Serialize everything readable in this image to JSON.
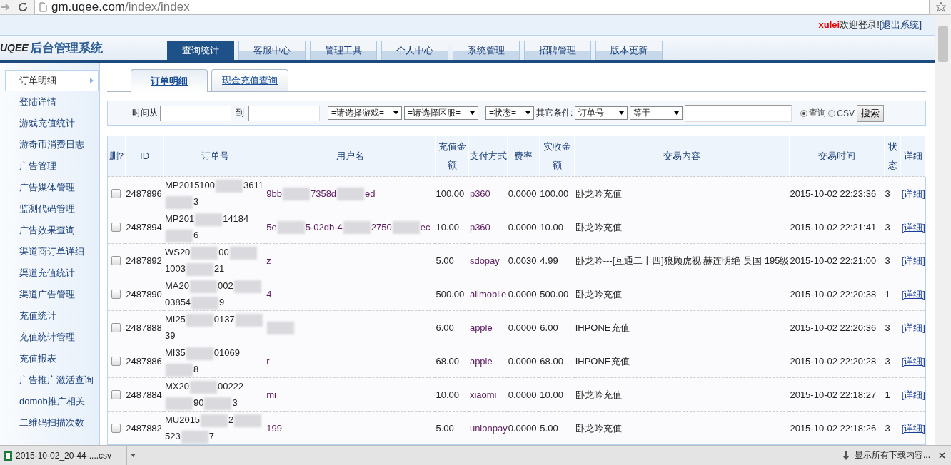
{
  "browser": {
    "url_host": "gm.uqee.com",
    "url_path": "/index/index"
  },
  "header": {
    "logo_brand": "UQEE",
    "logo_title": "后台管理系统",
    "user": "xulei",
    "welcome": "欢迎登录!",
    "logout": "[退出系统]"
  },
  "nav": [
    {
      "label": "查询统计",
      "selected": true
    },
    {
      "label": "客服中心",
      "selected": false
    },
    {
      "label": "管理工具",
      "selected": false
    },
    {
      "label": "个人中心",
      "selected": false
    },
    {
      "label": "系统管理",
      "selected": false
    },
    {
      "label": "招聘管理",
      "selected": false
    },
    {
      "label": "版本更新",
      "selected": false
    }
  ],
  "sidebar": {
    "items": [
      {
        "label": "订单明细",
        "selected": true
      },
      {
        "label": "登陆详情",
        "selected": false
      },
      {
        "label": "游戏充值统计",
        "selected": false
      },
      {
        "label": "游奇币消费日志",
        "selected": false
      },
      {
        "label": "广告管理",
        "selected": false
      },
      {
        "label": "广告媒体管理",
        "selected": false
      },
      {
        "label": "监测代码管理",
        "selected": false
      },
      {
        "label": "广告效果查询",
        "selected": false
      },
      {
        "label": "渠道商订单详细",
        "selected": false
      },
      {
        "label": "渠道充值统计",
        "selected": false
      },
      {
        "label": "渠道广告管理",
        "selected": false
      },
      {
        "label": "充值统计",
        "selected": false
      },
      {
        "label": "充值统计管理",
        "selected": false
      },
      {
        "label": "充值报表",
        "selected": false
      },
      {
        "label": "广告推广激活查询",
        "selected": false
      },
      {
        "label": "domob推广相关",
        "selected": false
      },
      {
        "label": "二维码扫描次数",
        "selected": false
      }
    ]
  },
  "tabs": [
    {
      "label": "订单明细",
      "selected": true
    },
    {
      "label": "现金充值查询",
      "selected": false
    }
  ],
  "filters": {
    "time_from_label": "时间从",
    "time_to_label": "到",
    "game_select": "=请选择游戏=",
    "server_select": "=请选择区服=",
    "status_select": "=状态=",
    "other_label": "其它条件:",
    "field_select": "订单号",
    "op_select": "等于",
    "modes": [
      {
        "label": "查询",
        "selected": true
      },
      {
        "label": "CSV",
        "selected": false
      }
    ],
    "search_button": "搜索"
  },
  "table": {
    "columns": [
      "删?",
      "ID",
      "订单号",
      "用户名",
      "充值金额",
      "支付方式",
      "费率",
      "实收金额",
      "交易内容",
      "交易时间",
      "状态",
      "详细"
    ],
    "rows": [
      {
        "checked": false,
        "id": "2487896",
        "order": [
          "MP2015100",
          "3611",
          "3"
        ],
        "user": [
          "9bb",
          "7358d",
          "ed"
        ],
        "amount": "100.00",
        "pay": "p360",
        "rate": "0.0000",
        "actual": "100.00",
        "content": "卧龙吟充值",
        "time": "2015-10-02 22:23:36",
        "status": "3",
        "detail": "[详细]"
      },
      {
        "checked": false,
        "id": "2487894",
        "order": [
          "MP201",
          "14184",
          "6"
        ],
        "user": [
          "5e",
          "5-02db-4",
          "2750",
          "ec"
        ],
        "amount": "10.00",
        "pay": "p360",
        "rate": "0.0000",
        "actual": "10.00",
        "content": "卧龙吟充值",
        "time": "2015-10-02 22:21:41",
        "status": "3",
        "detail": "[详细]"
      },
      {
        "checked": false,
        "id": "2487892",
        "order": [
          "WS20",
          "00",
          "1003",
          "21"
        ],
        "user": [
          "z"
        ],
        "amount": "5.00",
        "pay": "sdopay",
        "rate": "0.0030",
        "actual": "4.99",
        "content": "卧龙吟---[互通二十四]狼顾虎视 赫连明绝 吴国 195级",
        "time": "2015-10-02 22:21:00",
        "status": "3",
        "detail": "[详细]"
      },
      {
        "checked": false,
        "id": "2487890",
        "order": [
          "MA20",
          "002",
          "03854",
          "9"
        ],
        "user": [
          "4"
        ],
        "amount": "500.00",
        "pay": "alimobile",
        "rate": "0.0000",
        "actual": "500.00",
        "content": "卧龙吟充值",
        "time": "2015-10-02 22:20:38",
        "status": "1",
        "detail": "[详细]"
      },
      {
        "checked": false,
        "id": "2487888",
        "order": [
          "MI25",
          "0137",
          "39"
        ],
        "user": [],
        "amount": "6.00",
        "pay": "apple",
        "rate": "0.0000",
        "actual": "6.00",
        "content": "IHPONE充值",
        "time": "2015-10-02 22:20:36",
        "status": "3",
        "detail": "[详细]"
      },
      {
        "checked": false,
        "id": "2487886",
        "order": [
          "MI35",
          "01069",
          "8"
        ],
        "user": [
          "r"
        ],
        "amount": "68.00",
        "pay": "apple",
        "rate": "0.0000",
        "actual": "68.00",
        "content": "IHPONE充值",
        "time": "2015-10-02 22:20:28",
        "status": "3",
        "detail": "[详细]"
      },
      {
        "checked": false,
        "id": "2487884",
        "order": [
          "MX20",
          "00222",
          "90",
          "3"
        ],
        "user": [
          "mi"
        ],
        "amount": "10.00",
        "pay": "xiaomi",
        "rate": "0.0000",
        "actual": "10.00",
        "content": "卧龙吟充值",
        "time": "2015-10-02 22:18:27",
        "status": "1",
        "detail": "[详细]"
      },
      {
        "checked": false,
        "id": "2487882",
        "order": [
          "MU2015",
          "2",
          "523",
          "7"
        ],
        "user": [
          "199"
        ],
        "amount": "5.00",
        "pay": "unionpay",
        "rate": "0.0000",
        "actual": "5.00",
        "content": "卧龙吟充值",
        "time": "2015-10-02 22:18:26",
        "status": "3",
        "detail": "[详细]"
      }
    ]
  },
  "downloads": {
    "file": "2015-10-02_20-44-....csv",
    "show_all": "显示所有下载内容..."
  }
}
